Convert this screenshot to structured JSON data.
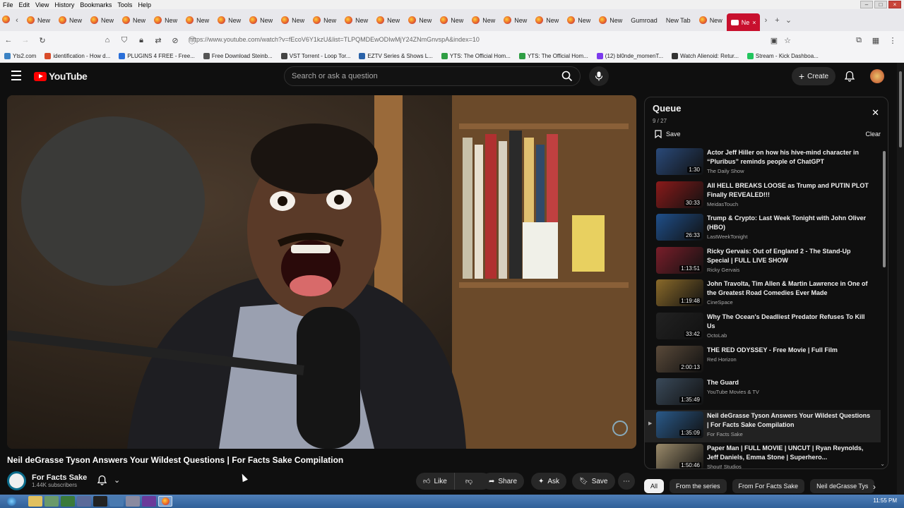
{
  "menubar": {
    "items": [
      "File",
      "Edit",
      "View",
      "History",
      "Bookmarks",
      "Tools",
      "Help"
    ]
  },
  "tabs": {
    "items": [
      "New",
      "New",
      "New",
      "New",
      "New",
      "New",
      "New",
      "New",
      "New",
      "New",
      "New",
      "New",
      "New",
      "New",
      "New",
      "New",
      "New",
      "New",
      "New",
      "Gumroad",
      "New Tab",
      "New"
    ],
    "active_label": "Ne"
  },
  "navbar": {
    "url": "https://www.youtube.com/watch?v=fEcoV6Y1kzU&list=TLPQMDEwODIwMjY24ZNmGnvspA&index=10"
  },
  "bookmarks": {
    "items": [
      {
        "label": "Yts2.com",
        "color": "#3b82c4"
      },
      {
        "label": "identification - How d...",
        "color": "#d94c2a"
      },
      {
        "label": "PLUGINS 4 FREE - Free...",
        "color": "#2a6fd9"
      },
      {
        "label": "Free Download Steinb...",
        "color": "#555555"
      },
      {
        "label": "VST Torrent - Loop Tor...",
        "color": "#444444"
      },
      {
        "label": "EZTV Series & Shows L...",
        "color": "#2a62a8"
      },
      {
        "label": "YTS: The Official Hom...",
        "color": "#2f9e44"
      },
      {
        "label": "YTS: The Official Hom...",
        "color": "#2f9e44"
      },
      {
        "label": "(12) bl0nde_momenT...",
        "color": "#7c3aed"
      },
      {
        "label": "Watch Alienoid: Retur...",
        "color": "#333333"
      },
      {
        "label": "Stream - Kick Dashboa...",
        "color": "#22c55e"
      }
    ]
  },
  "youtube": {
    "logo_text": "YouTube",
    "search_placeholder": "Search or ask a question",
    "create_label": "Create"
  },
  "video": {
    "title": "Neil deGrasse Tyson Answers Your Wildest Questions | For Facts Sake Compilation",
    "channel": "For Facts Sake",
    "subscribers": "1.44K subscribers"
  },
  "actions": {
    "like": "Like",
    "share": "Share",
    "ask": "Ask",
    "save": "Save"
  },
  "queue": {
    "title": "Queue",
    "counter": "9 / 27",
    "save_label": "Save",
    "clear_label": "Clear",
    "items": [
      {
        "title": "Actor Jeff Hiller on how his hive-mind character in “Pluribus” reminds people of ChatGPT",
        "channel": "The Daily Show",
        "duration": "1:30",
        "thumb": "#2a4a7a"
      },
      {
        "title": "All HELL BREAKS LOOSE as Trump and PUTIN PLOT Finally REVEALED!!!",
        "channel": "MeidasTouch",
        "duration": "30:33",
        "thumb": "#8a1a1a"
      },
      {
        "title": "Trump & Crypto: Last Week Tonight with John Oliver (HBO)",
        "channel": "LastWeekTonight",
        "duration": "26:33",
        "thumb": "#1f4f8a"
      },
      {
        "title": "Ricky Gervais: Out of England 2 - The Stand-Up Special | FULL LIVE SHOW",
        "channel": "Ricky Gervais",
        "duration": "1:13:51",
        "thumb": "#7a1e2a"
      },
      {
        "title": "John Travolta, Tim Allen & Martin Lawrence in One of the Greatest Road Comedies Ever Made",
        "channel": "CineSpace",
        "duration": "1:19:48",
        "thumb": "#8a6a2a"
      },
      {
        "title": "Why The Ocean's Deadliest Predator Refuses To Kill Us",
        "channel": "OctoLab",
        "duration": "33:42",
        "thumb": "#222222"
      },
      {
        "title": "THE RED ODYSSEY - Free Movie | Full Film",
        "channel": "Red Horizon",
        "duration": "2:00:13",
        "thumb": "#5a4a3a"
      },
      {
        "title": "The Guard",
        "channel": "YouTube Movies & TV",
        "duration": "1:35:49",
        "thumb": "#3a4a5a"
      },
      {
        "title": "Neil deGrasse Tyson Answers Your Wildest Questions | For Facts Sake Compilation",
        "channel": "For Facts Sake",
        "duration": "1:35:09",
        "thumb": "#2a5a8a",
        "current": true
      },
      {
        "title": "Paper Man | FULL MOVIE | UNCUT | Ryan Reynolds, Jeff Daniels, Emma Stone | Superhero...",
        "channel": "Shout! Studios",
        "duration": "1:50:46",
        "thumb": "#9a8a6a"
      }
    ]
  },
  "chips": [
    "All",
    "From the series",
    "From For Facts Sake",
    "Neil deGrasse Tys"
  ],
  "taskbar": {
    "clock": "11:55 PM"
  }
}
